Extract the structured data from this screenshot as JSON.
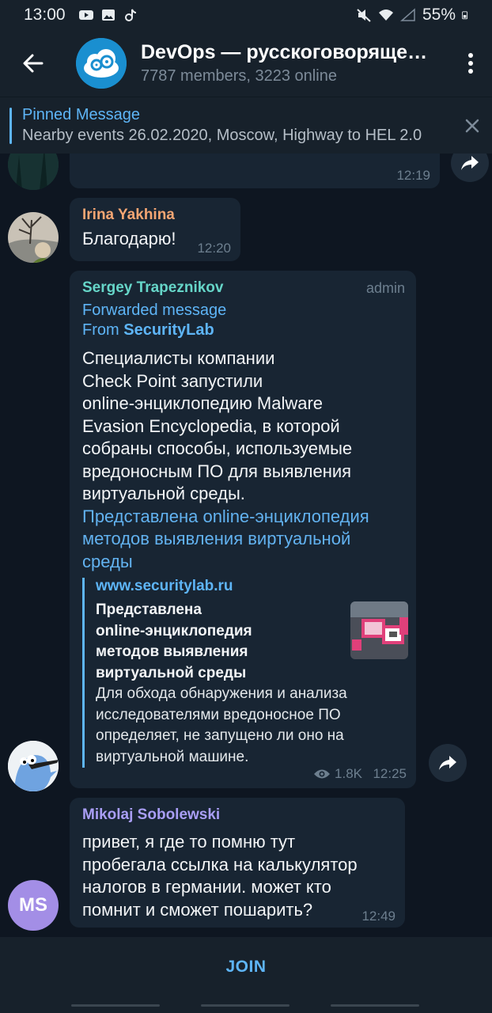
{
  "status_bar": {
    "time": "13:00",
    "battery": "55%"
  },
  "header": {
    "title": "DevOps — русскоговорящее сообщество",
    "subtitle": "7787 members, 3223 online"
  },
  "pinned": {
    "title": "Pinned Message",
    "text": "Nearby events 26.02.2020, Moscow, Highway to HEL 2.0"
  },
  "messages": [
    {
      "time": "12:19"
    },
    {
      "author": "Irina Yakhina",
      "text": "Благодарю!",
      "time": "12:20"
    },
    {
      "author": "Sergey Trapeznikov",
      "badge": "admin",
      "forwarded_label": "Forwarded message",
      "from_label": "From",
      "from_source": "SecurityLab",
      "text_lines": [
        "Специалисты компании",
        "Check Point запустили",
        "online-энциклопедию Malware",
        "Evasion Encyclopedia, в которой",
        "собраны способы, используемые",
        "вредоносным ПО для выявления",
        "виртуальной среды."
      ],
      "link_lines": [
        "Представлена online-энциклопедия",
        "методов выявления виртуальной",
        "среды"
      ],
      "preview": {
        "site": "www.securitylab.ru",
        "title_lines": [
          "Представлена",
          "online-энциклопедия",
          "методов выявления",
          "виртуальной среды"
        ],
        "desc_lines": [
          "Для обхода обнаружения и анализа",
          "исследователями вредоносное ПО",
          "определяет, не запущено ли оно на",
          "виртуальной машине."
        ]
      },
      "views": "1.8K",
      "time": "12:25"
    },
    {
      "author": "Mikolaj Sobolewski",
      "avatar_initials": "MS",
      "text_lines": [
        "привет, я где то помню тут",
        "пробегала ссылка на калькулятор",
        "налогов в германии. может кто",
        "помнит и сможет пошарить?"
      ],
      "time": "12:49"
    }
  ],
  "join_label": "JOIN",
  "colors": {
    "bg": "#0e1621",
    "bar": "#17212b",
    "bubble": "#182533",
    "accent": "#5eb5f7",
    "irina": "#f5a673",
    "sergey": "#66d5c8",
    "mikolaj": "#a99ef5",
    "ms_avatar": "#a38ee6"
  }
}
